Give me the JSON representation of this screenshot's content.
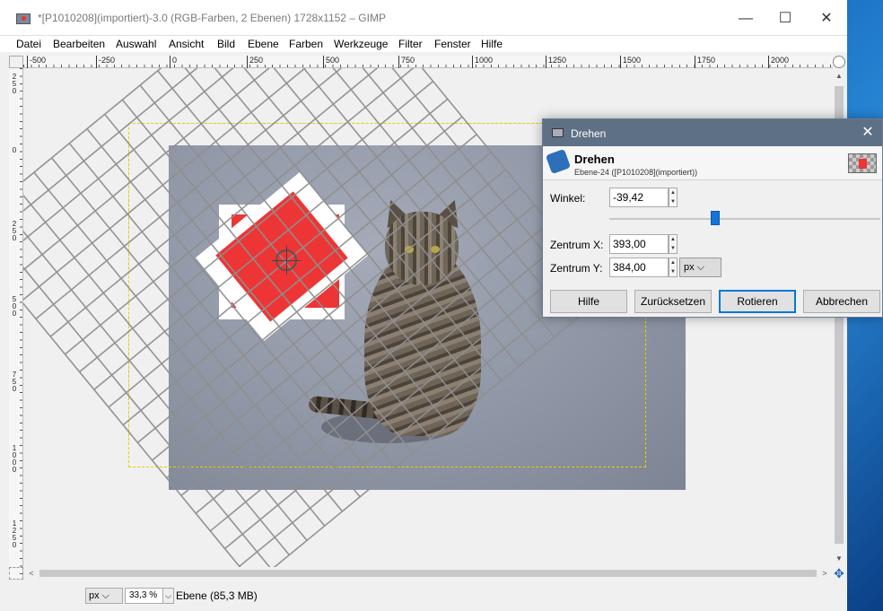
{
  "window": {
    "title": "*[P1010208](importiert)-3.0 (RGB-Farben, 2 Ebenen) 1728x1152 – GIMP",
    "minimize": "—",
    "maximize": "☐",
    "close": "✕"
  },
  "menu": [
    "Datei",
    "Bearbeiten",
    "Auswahl",
    "Ansicht",
    "Bild",
    "Ebene",
    "Farben",
    "Werkzeuge",
    "Filter",
    "Fenster",
    "Hilfe"
  ],
  "hruler_ticks": [
    "-500",
    "-250",
    "0",
    "250",
    "500",
    "750",
    "1000",
    "1250",
    "1500",
    "1750",
    "2000"
  ],
  "vruler_ticks": [
    "250",
    "0",
    "250",
    "500",
    "750",
    "1000",
    "1250"
  ],
  "statusbar": {
    "unit": "px",
    "zoom": "33,3 %",
    "text": "Ebene (85,3 MB)"
  },
  "dialog": {
    "title": "Drehen",
    "close": "✕",
    "heading": "Drehen",
    "subheading": "Ebene-24 ([P1010208](importiert))",
    "angle_label": "Winkel:",
    "angle_value": "-39,42",
    "center_x_label": "Zentrum X:",
    "center_x_value": "393,00",
    "center_y_label": "Zentrum Y:",
    "center_y_value": "384,00",
    "unit": "px",
    "angle_slider_fraction": 0.39,
    "buttons": {
      "help": "Hilfe",
      "reset": "Zurücksetzen",
      "rotate": "Rotieren",
      "cancel": "Abbrechen"
    }
  },
  "colors": {
    "layer_red": "#ee3535",
    "dialog_titlebar": "#5e7085",
    "accent": "#0078d7"
  }
}
